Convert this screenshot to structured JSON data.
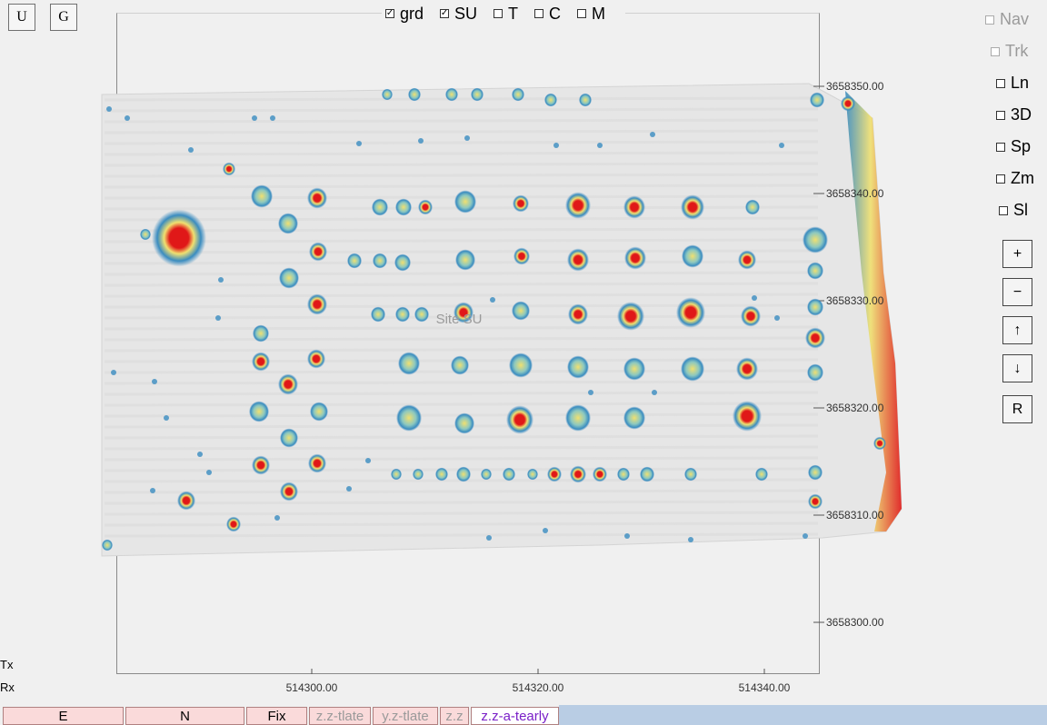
{
  "toolbar": {
    "u_label": "U",
    "g_label": "G"
  },
  "layers": [
    {
      "label": "grd",
      "checked": true
    },
    {
      "label": "SU",
      "checked": true
    },
    {
      "label": "T",
      "checked": false
    },
    {
      "label": "C",
      "checked": false
    },
    {
      "label": "M",
      "checked": false
    }
  ],
  "side_options": [
    {
      "label": "Nav",
      "enabled": false
    },
    {
      "label": "Trk",
      "enabled": false
    },
    {
      "label": "Ln",
      "enabled": true
    },
    {
      "label": "3D",
      "enabled": true
    },
    {
      "label": "Sp",
      "enabled": true
    },
    {
      "label": "Zm",
      "enabled": true
    },
    {
      "label": "Sl",
      "enabled": true
    }
  ],
  "nav_buttons": {
    "zoom_in": "+",
    "zoom_out": "−",
    "up": "↑",
    "down": "↓",
    "reset": "R"
  },
  "plot": {
    "site_label": "Site SU",
    "y_ticks": [
      "3658350.00",
      "3658340.00",
      "3658330.00",
      "3658320.00",
      "3658310.00",
      "3658300.00"
    ],
    "x_ticks": [
      "514300.00",
      "514320.00",
      "514340.00"
    ]
  },
  "labels": {
    "tx": "Tx",
    "rx": "Rx"
  },
  "status": {
    "e": "E",
    "n": "N",
    "fix": "Fix",
    "zz_tlate": "z.z-tlate",
    "yz_tlate": "y.z-tlate",
    "zz": "z.z",
    "zz_a_tearly": "z.z-a-tearly"
  },
  "colors": {
    "anomaly_high": "#e01818",
    "anomaly_mid": "#f0e070",
    "anomaly_low": "#3a8cc0",
    "accent_status": "#7a20c8"
  }
}
